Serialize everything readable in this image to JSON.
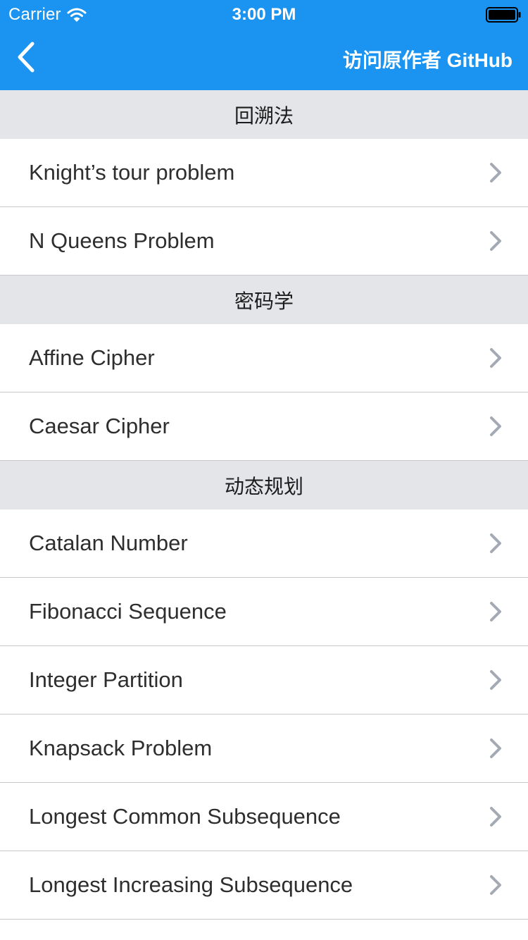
{
  "status_bar": {
    "carrier": "Carrier",
    "time": "3:00 PM",
    "icons": [
      "wifi-icon",
      "battery-icon"
    ]
  },
  "nav": {
    "back_icon": "chevron-left-icon",
    "link_label": "访问原作者 GitHub",
    "background_color": "#1a94f0",
    "text_color": "#ffffff"
  },
  "sections": [
    {
      "title": "回溯法",
      "items": [
        {
          "label": "Knight’s tour problem"
        },
        {
          "label": "N Queens Problem"
        }
      ]
    },
    {
      "title": "密码学",
      "items": [
        {
          "label": "Affine Cipher"
        },
        {
          "label": "Caesar Cipher"
        }
      ]
    },
    {
      "title": "动态规划",
      "items": [
        {
          "label": "Catalan Number"
        },
        {
          "label": "Fibonacci Sequence"
        },
        {
          "label": "Integer Partition"
        },
        {
          "label": "Knapsack Problem"
        },
        {
          "label": "Longest Common Subsequence"
        },
        {
          "label": "Longest Increasing Subsequence"
        }
      ]
    }
  ],
  "row_icon": "chevron-right-icon",
  "colors": {
    "section_bg": "#e4e5e9",
    "separator": "#c8c8cc",
    "chevron": "#a4aab3"
  }
}
